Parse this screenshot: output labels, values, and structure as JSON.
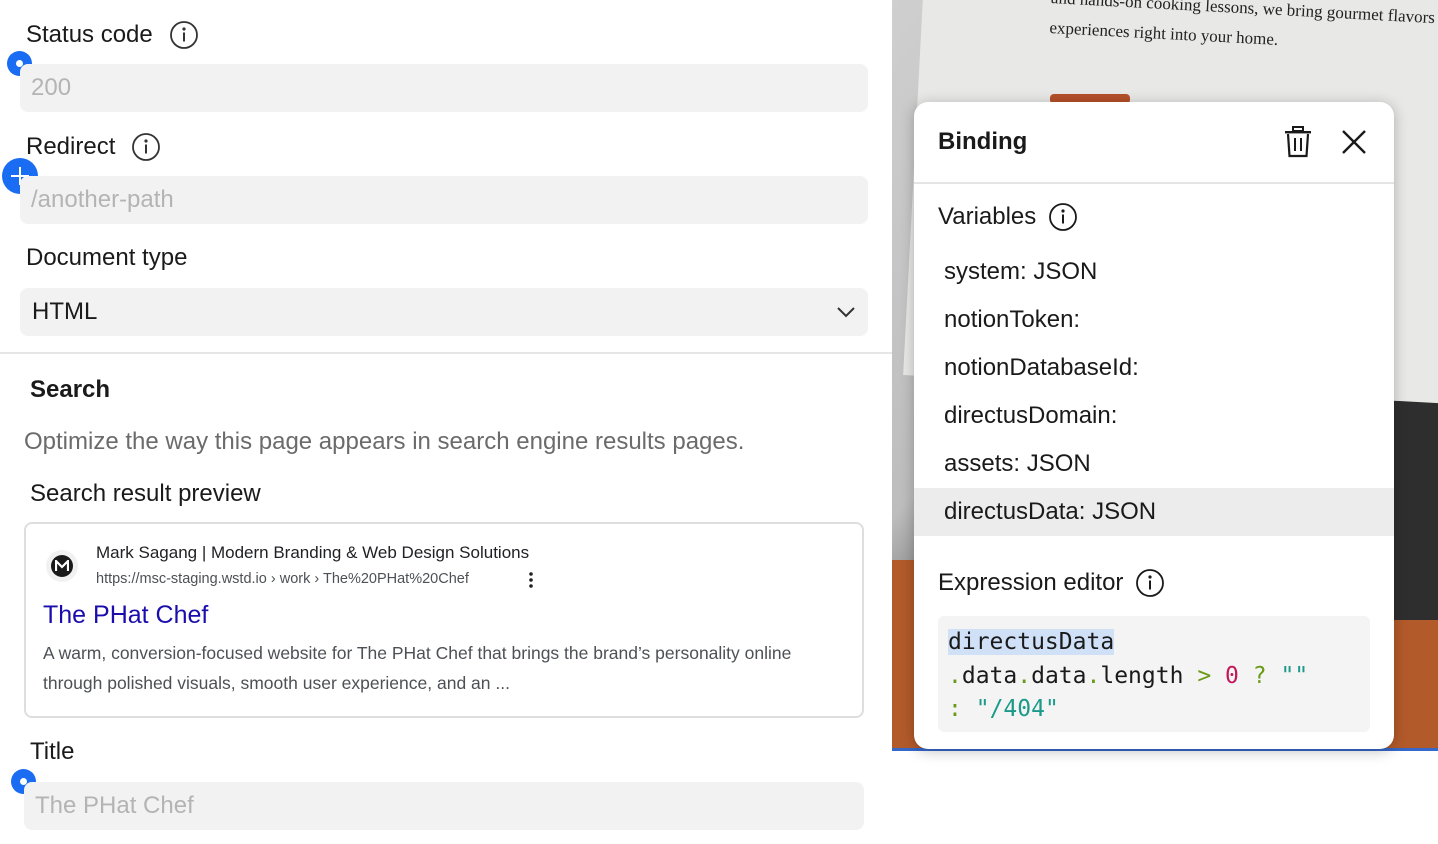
{
  "settings": {
    "status_code": {
      "label": "Status code",
      "placeholder": "200"
    },
    "redirect": {
      "label": "Redirect",
      "placeholder": "/another-path"
    },
    "document_type": {
      "label": "Document type",
      "value": "HTML"
    },
    "search": {
      "title": "Search",
      "description": "Optimize the way this page appears in search engine results pages.",
      "preview_label": "Search result preview",
      "preview": {
        "site_name": "Mark Sagang | Modern Branding & Web Design Solutions",
        "url": "https://msc-staging.wstd.io › work › The%20PHat%20Chef",
        "title": "The PHat Chef",
        "description": "A warm, conversion-focused website for The PHat Chef that brings the brand’s personality online through polished visuals, smooth user experience, and an ..."
      }
    },
    "title_field": {
      "label": "Title",
      "placeholder": "The PHat Chef"
    }
  },
  "canvas": {
    "photo_text": "and hands-on cooking lessons, we bring gourmet flavors and experiences right into your home."
  },
  "binding_popover": {
    "title": "Binding",
    "variables_label": "Variables",
    "variables": [
      "system: JSON",
      "notionToken:",
      "notionDatabaseId:",
      "directusDomain:",
      "assets: JSON",
      "directusData: JSON"
    ],
    "selected_variable_index": 5,
    "expression_label": "Expression editor",
    "expression": {
      "tok_var": "directusData",
      "tok_dot1": ".",
      "tok_data1": "data",
      "tok_dot2": ".",
      "tok_data2": "data",
      "tok_dot3": ".",
      "tok_length": "length",
      "tok_gt": ">",
      "tok_zero": "0",
      "tok_q": "?",
      "tok_empty": "\"\"",
      "tok_colon": ":",
      "tok_404": "\"/404\""
    }
  },
  "colors": {
    "accent": "#1a6cf2",
    "serp_title": "#1a0dab",
    "input_bg": "#f2f2f2"
  }
}
